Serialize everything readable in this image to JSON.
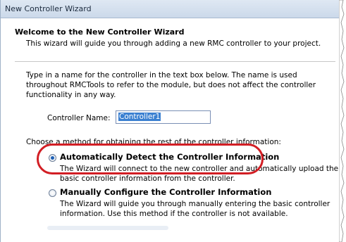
{
  "window": {
    "title": "New Controller Wizard"
  },
  "header": {
    "title": "Welcome to the New Controller Wizard",
    "subtitle": "This wizard will guide you through adding a new RMC controller to your project."
  },
  "intro": "Type in a name for the controller in the text box below. The name is used throughout RMCTools to refer to the module, but does not affect the controller functionality in any way.",
  "controller_name": {
    "label": "Controller Name:",
    "value": "Controller1"
  },
  "method_prompt": "Choose a method for obtaining the rest of the controller information:",
  "options": [
    {
      "label": "Automatically Detect the Controller Information",
      "description": "The Wizard will connect to the new controller and automatically upload the basic controller information from the controller.",
      "selected": true
    },
    {
      "label": "Manually Configure the Controller Information",
      "description": "The Wizard will guide you through manually entering the basic controller information. Use this method if the controller is not available.",
      "selected": false
    }
  ],
  "colors": {
    "highlight": "#d21e24",
    "titlebar": "#cbd9ea",
    "selection": "#3b80d1"
  }
}
